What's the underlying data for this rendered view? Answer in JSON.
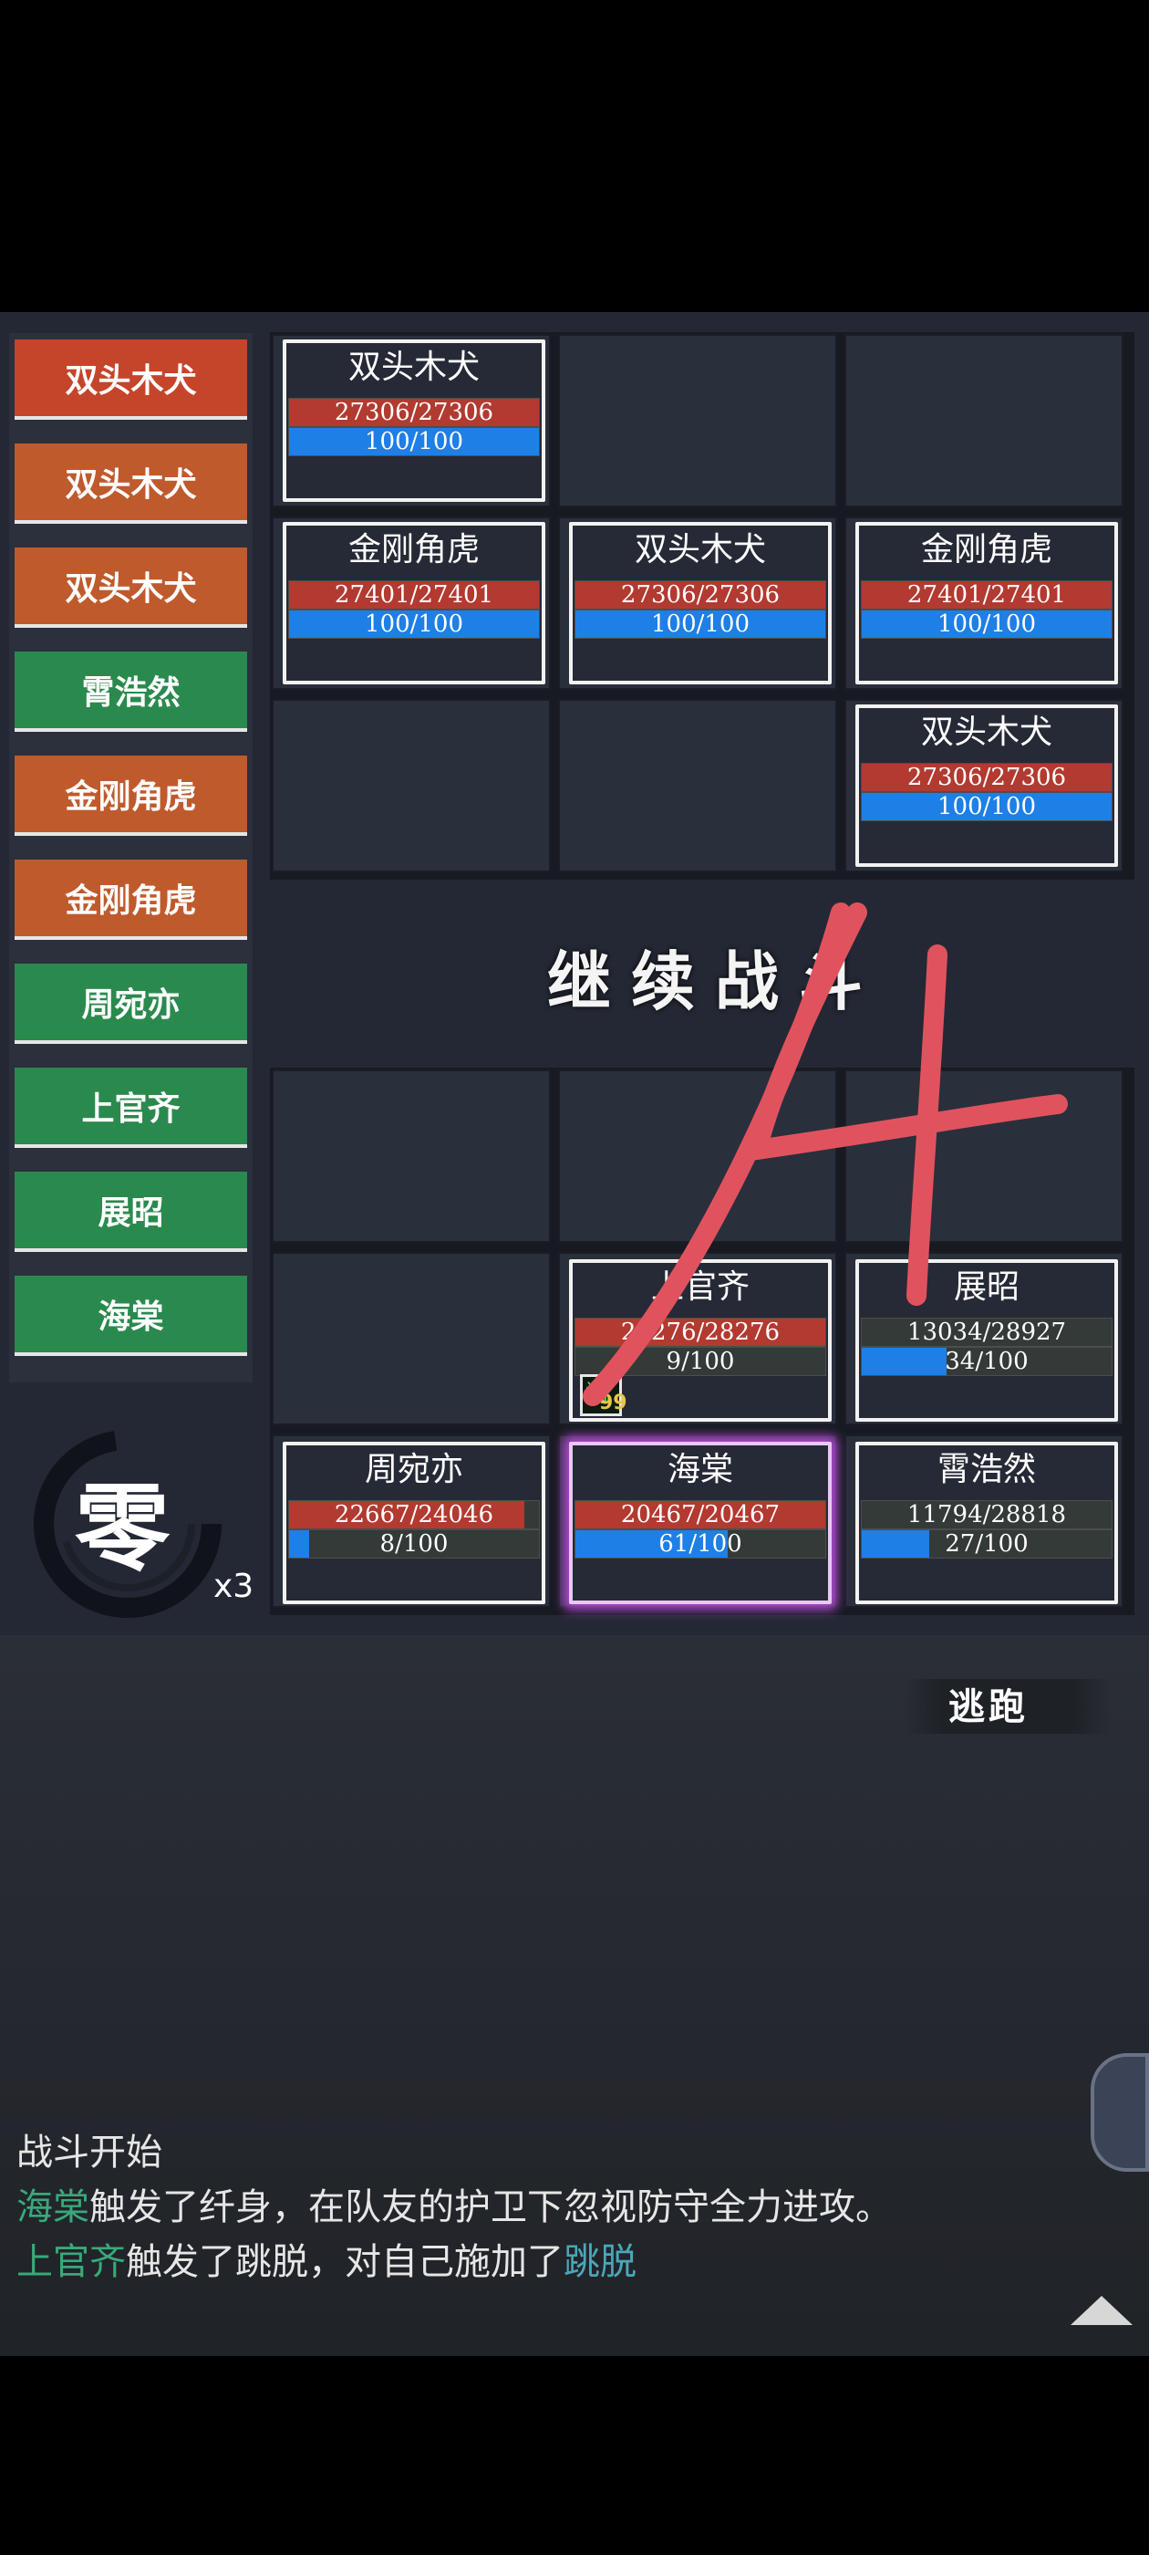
{
  "colors": {
    "turn_red": "#c5452b",
    "turn_orange": "#bf5a2d",
    "turn_green": "#2a8a4e",
    "hp": "#b23a30",
    "mp": "#1e7fe6",
    "highlight_green": "#38a97a",
    "highlight_cyan": "#4aa7b8"
  },
  "turn_order": [
    {
      "label": "双头木犬",
      "team": "enemy",
      "current": true
    },
    {
      "label": "双头木犬",
      "team": "enemy"
    },
    {
      "label": "双头木犬",
      "team": "enemy"
    },
    {
      "label": "霄浩然",
      "team": "ally"
    },
    {
      "label": "金刚角虎",
      "team": "enemy"
    },
    {
      "label": "金刚角虎",
      "team": "enemy"
    },
    {
      "label": "周宛亦",
      "team": "ally"
    },
    {
      "label": "上官齐",
      "team": "ally"
    },
    {
      "label": "展昭",
      "team": "ally"
    },
    {
      "label": "海棠",
      "team": "ally"
    }
  ],
  "enemies": [
    {
      "name": "双头木犬",
      "hp": "27306/27306",
      "hp_pct": 100,
      "mp": "100/100",
      "mp_pct": 100
    },
    {
      "name": "金刚角虎",
      "hp": "27401/27401",
      "hp_pct": 100,
      "mp": "100/100",
      "mp_pct": 100
    },
    {
      "name": "双头木犬",
      "hp": "27306/27306",
      "hp_pct": 100,
      "mp": "100/100",
      "mp_pct": 100
    },
    {
      "name": "金刚角虎",
      "hp": "27401/27401",
      "hp_pct": 100,
      "mp": "100/100",
      "mp_pct": 100
    },
    {
      "name": "双头木犬",
      "hp": "27306/27306",
      "hp_pct": 100,
      "mp": "100/100",
      "mp_pct": 100
    }
  ],
  "allies": [
    {
      "name": "上官齐",
      "hp": "28276/28276",
      "hp_pct": 100,
      "mp": "9/100",
      "mp_pct": 0
    },
    {
      "name": "展昭",
      "hp": "13034/28927",
      "hp_pct": 0,
      "mp": "34/100",
      "mp_pct": 34
    },
    {
      "name": "周宛亦",
      "hp": "22667/24046",
      "hp_pct": 94,
      "mp": "8/100",
      "mp_pct": 8
    },
    {
      "name": "海棠",
      "hp": "20467/20467",
      "hp_pct": 100,
      "mp": "61/100",
      "mp_pct": 61,
      "active": true
    },
    {
      "name": "霄浩然",
      "hp": "11794/28818",
      "hp_pct": 0,
      "mp": "27/100",
      "mp_pct": 27
    }
  ],
  "status_effect": {
    "glyph": "闪",
    "count": "99"
  },
  "continue_label": "继续战斗",
  "speed": {
    "char": "零",
    "multiplier": "x3"
  },
  "flee_label": "逃跑",
  "log": {
    "line1": "战斗开始",
    "line2_name": "海棠",
    "line2_rest": "触发了纤身，在队友的护卫下忽视防守全力进攻。",
    "line3_name": "上官齐",
    "line3_mid": "触发了跳脱，对自己施加了",
    "line3_effect": "跳脱"
  },
  "handwritten_overlay": "14"
}
